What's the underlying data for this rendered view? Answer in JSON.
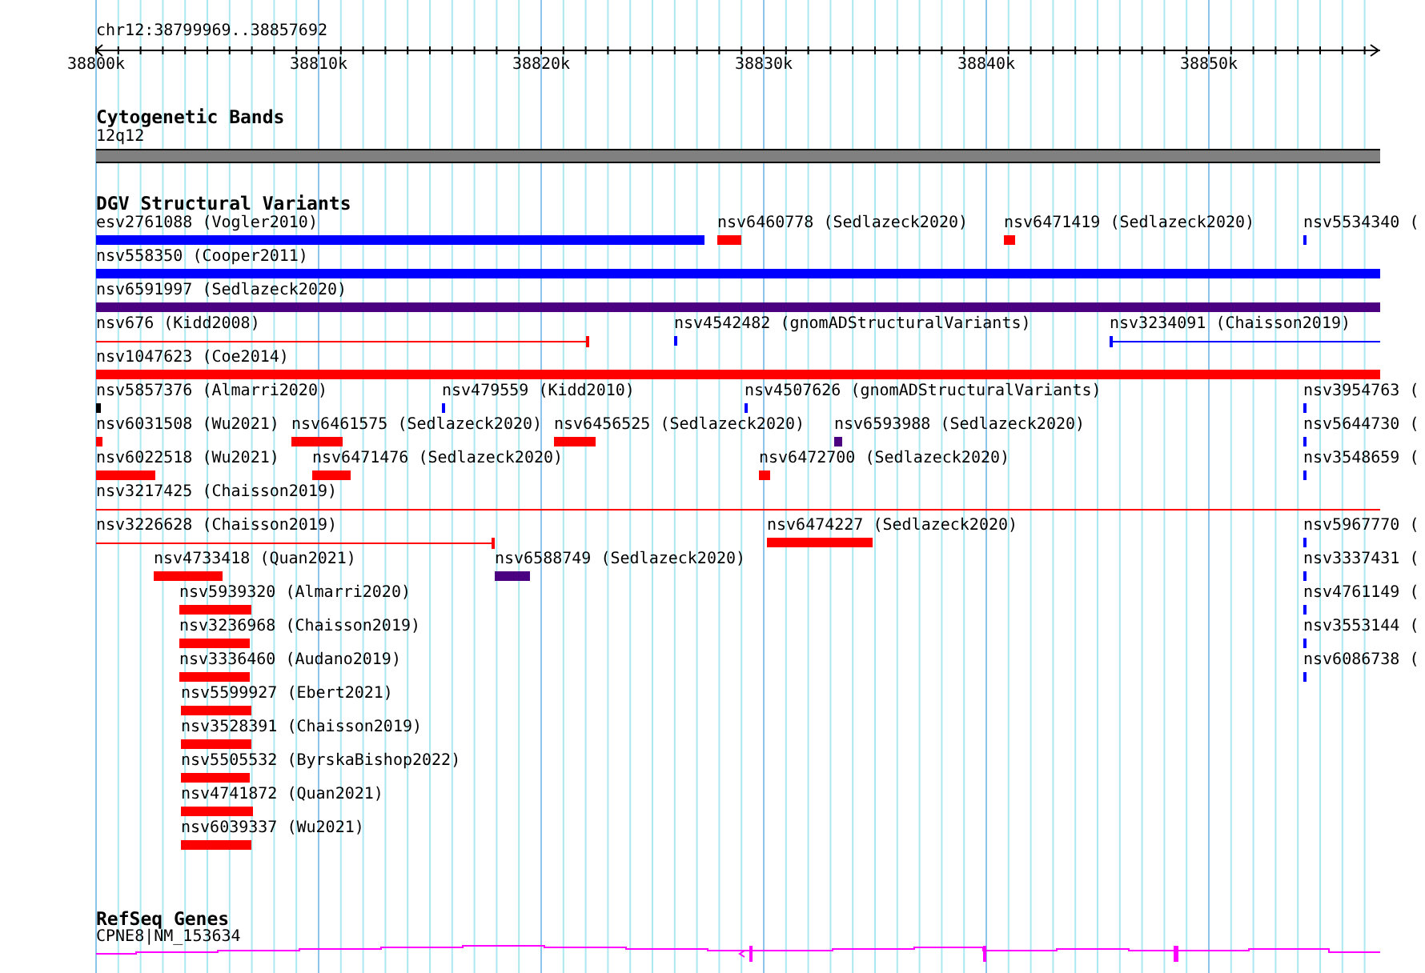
{
  "ruler": {
    "region": "chr12:38799969..38857692",
    "ticks": [
      "38800k",
      "38810k",
      "38820k",
      "38830k",
      "38840k",
      "38850k"
    ]
  },
  "cytobands": {
    "title": "Cytogenetic Bands",
    "band": "12q12"
  },
  "dgv": {
    "title": "DGV Structural Variants",
    "rows": [
      {
        "features": [
          {
            "label": "esv2761088 (Vogler2010)",
            "kind": "bar",
            "color": "#0000ff"
          },
          {
            "label": "nsv6460778 (Sedlazeck2020)",
            "kind": "bar",
            "color": "#ff0000"
          },
          {
            "label": "nsv6471419 (Sedlazeck2020)",
            "kind": "bar",
            "color": "#ff0000"
          },
          {
            "label": "nsv5534340 (",
            "kind": "tick",
            "color": "#0000ff"
          }
        ]
      },
      {
        "features": [
          {
            "label": "nsv558350 (Cooper2011)",
            "kind": "bar",
            "color": "#0000ff"
          }
        ]
      },
      {
        "features": [
          {
            "label": "nsv6591997 (Sedlazeck2020)",
            "kind": "bar",
            "color": "#4b0082"
          }
        ]
      },
      {
        "features": [
          {
            "label": "nsv676 (Kidd2008)",
            "kind": "span",
            "color": "#ff0000"
          },
          {
            "label": "nsv4542482 (gnomADStructuralVariants)",
            "kind": "tick",
            "color": "#0000ff"
          },
          {
            "label": "nsv3234091 (Chaisson2019)",
            "kind": "span",
            "color": "#0000ff"
          }
        ]
      },
      {
        "features": [
          {
            "label": "nsv1047623 (Coe2014)",
            "kind": "bar",
            "color": "#ff0000"
          }
        ]
      },
      {
        "features": [
          {
            "label": "nsv5857376 (Almarri2020)",
            "kind": "bar",
            "color": "#000000"
          },
          {
            "label": "nsv479559 (Kidd2010)",
            "kind": "tick",
            "color": "#0000ff"
          },
          {
            "label": "nsv4507626 (gnomADStructuralVariants)",
            "kind": "tick",
            "color": "#0000ff"
          },
          {
            "label": "nsv3954763 (",
            "kind": "tick",
            "color": "#0000ff"
          }
        ]
      },
      {
        "features": [
          {
            "label": "nsv6031508 (Wu2021)",
            "kind": "bar",
            "color": "#ff0000"
          },
          {
            "label": "nsv6461575 (Sedlazeck2020)",
            "kind": "bar",
            "color": "#ff0000"
          },
          {
            "label": "nsv6456525 (Sedlazeck2020)",
            "kind": "bar",
            "color": "#ff0000"
          },
          {
            "label": "nsv6593988 (Sedlazeck2020)",
            "kind": "bar",
            "color": "#4b0082"
          },
          {
            "label": "nsv5644730 (",
            "kind": "tick",
            "color": "#0000ff"
          }
        ]
      },
      {
        "features": [
          {
            "label": "nsv6022518 (Wu2021)",
            "kind": "bar",
            "color": "#ff0000"
          },
          {
            "label": "nsv6471476 (Sedlazeck2020)",
            "kind": "bar",
            "color": "#ff0000"
          },
          {
            "label": "nsv6472700 (Sedlazeck2020)",
            "kind": "bar",
            "color": "#ff0000"
          },
          {
            "label": "nsv3548659 (",
            "kind": "tick",
            "color": "#0000ff"
          }
        ]
      },
      {
        "features": [
          {
            "label": "nsv3217425 (Chaisson2019)",
            "kind": "span",
            "color": "#ff0000"
          }
        ]
      },
      {
        "features": [
          {
            "label": "nsv3226628 (Chaisson2019)",
            "kind": "span",
            "color": "#ff0000"
          },
          {
            "label": "nsv6474227 (Sedlazeck2020)",
            "kind": "bar",
            "color": "#ff0000"
          },
          {
            "label": "nsv5967770 (",
            "kind": "tick",
            "color": "#0000ff"
          }
        ]
      },
      {
        "features": [
          {
            "label": "nsv4733418 (Quan2021)",
            "kind": "bar",
            "color": "#ff0000"
          },
          {
            "label": "nsv6588749 (Sedlazeck2020)",
            "kind": "bar",
            "color": "#4b0082"
          },
          {
            "label": "nsv3337431 (",
            "kind": "tick",
            "color": "#0000ff"
          }
        ]
      },
      {
        "features": [
          {
            "label": "nsv5939320 (Almarri2020)",
            "kind": "bar",
            "color": "#ff0000"
          },
          {
            "label": "nsv4761149 (",
            "kind": "tick",
            "color": "#0000ff"
          }
        ]
      },
      {
        "features": [
          {
            "label": "nsv3236968 (Chaisson2019)",
            "kind": "bar",
            "color": "#ff0000"
          },
          {
            "label": "nsv3553144 (",
            "kind": "tick",
            "color": "#0000ff"
          }
        ]
      },
      {
        "features": [
          {
            "label": "nsv3336460 (Audano2019)",
            "kind": "bar",
            "color": "#ff0000"
          },
          {
            "label": "nsv6086738 (",
            "kind": "tick",
            "color": "#0000ff"
          }
        ]
      },
      {
        "features": [
          {
            "label": "nsv5599927 (Ebert2021)",
            "kind": "bar",
            "color": "#ff0000"
          }
        ]
      },
      {
        "features": [
          {
            "label": "nsv3528391 (Chaisson2019)",
            "kind": "bar",
            "color": "#ff0000"
          }
        ]
      },
      {
        "features": [
          {
            "label": "nsv5505532 (ByrskaBishop2022)",
            "kind": "bar",
            "color": "#ff0000"
          }
        ]
      },
      {
        "features": [
          {
            "label": "nsv4741872 (Quan2021)",
            "kind": "bar",
            "color": "#ff0000"
          }
        ]
      },
      {
        "features": [
          {
            "label": "nsv6039337 (Wu2021)",
            "kind": "bar",
            "color": "#ff0000"
          }
        ]
      }
    ]
  },
  "refseq": {
    "title": "RefSeq Genes",
    "gene": "CPNE8|NM_153634"
  }
}
